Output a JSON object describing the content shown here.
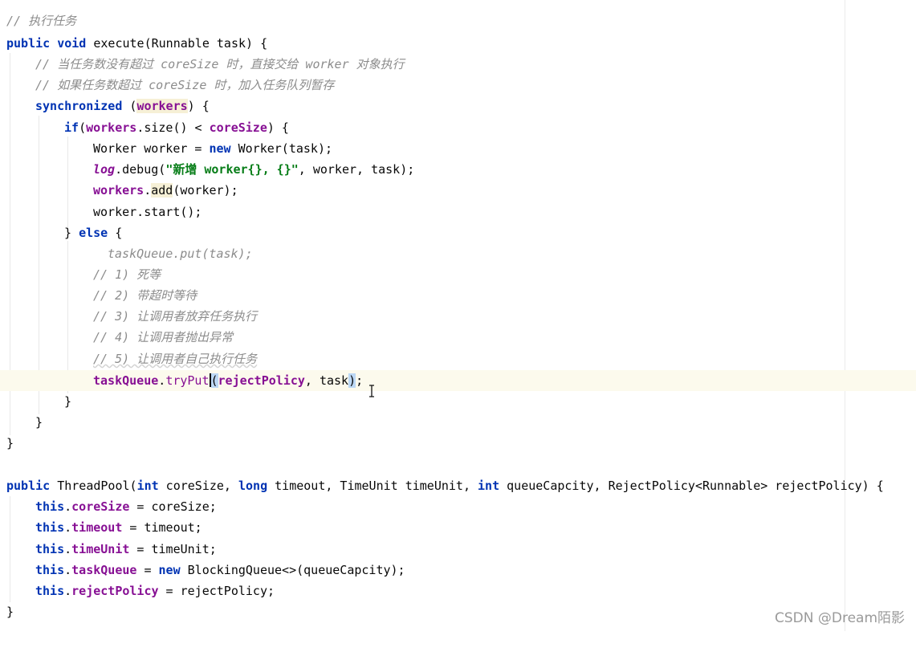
{
  "editor": {
    "lines": [
      {
        "t": "// 执行任务",
        "kind": "comment"
      },
      {
        "t": "public void execute(Runnable task) {",
        "kind": "code"
      },
      {
        "t": "// 当任务数没有超过 coreSize 时，直接交给 worker 对象执行",
        "kind": "comment"
      },
      {
        "t": "// 如果任务数超过 coreSize 时，加入任务队列暂存",
        "kind": "comment"
      },
      {
        "t": "synchronized (workers) {",
        "kind": "code"
      },
      {
        "t": "if(workers.size() < coreSize) {",
        "kind": "code"
      },
      {
        "t": "Worker worker = new Worker(task);",
        "kind": "code"
      },
      {
        "t": "log.debug(\"新增 worker{}, {}\", worker, task);",
        "kind": "code"
      },
      {
        "t": "workers.add(worker);",
        "kind": "code"
      },
      {
        "t": "worker.start();",
        "kind": "code"
      },
      {
        "t": "} else {",
        "kind": "code"
      },
      {
        "t": "taskQueue.put(task);",
        "kind": "code-disabled"
      },
      {
        "t": "// 1) 死等",
        "kind": "comment"
      },
      {
        "t": "// 2) 带超时等待",
        "kind": "comment"
      },
      {
        "t": "// 3) 让调用者放弃任务执行",
        "kind": "comment"
      },
      {
        "t": "// 4) 让调用者抛出异常",
        "kind": "comment"
      },
      {
        "t": "// 5) 让调用者自己执行任务",
        "kind": "comment"
      },
      {
        "t": "taskQueue.tryPut(rejectPolicy, task);",
        "kind": "code-current"
      },
      {
        "t": "}",
        "kind": "code"
      },
      {
        "t": "}",
        "kind": "code"
      },
      {
        "t": "}",
        "kind": "code"
      },
      {
        "t": "",
        "kind": "blank"
      },
      {
        "t": "public ThreadPool(int coreSize, long timeout, TimeUnit timeUnit, int queueCapcity, RejectPolicy<Runnable> rejectPolicy) {",
        "kind": "code"
      },
      {
        "t": "this.coreSize = coreSize;",
        "kind": "code"
      },
      {
        "t": "this.timeout = timeout;",
        "kind": "code"
      },
      {
        "t": "this.timeUnit = timeUnit;",
        "kind": "code"
      },
      {
        "t": "this.taskQueue = new BlockingQueue<>(queueCapcity);",
        "kind": "code"
      },
      {
        "t": "this.rejectPolicy = rejectPolicy;",
        "kind": "code"
      },
      {
        "t": "}",
        "kind": "code"
      }
    ],
    "tokens": {
      "l0_c": "// 执行任务",
      "l1_kw1": "public",
      "l1_kw2": "void",
      "l1_rest": " execute(Runnable task) {",
      "l2_c": "// 当任务数没有超过 coreSize 时，直接交给 worker 对象执行",
      "l3_c": "// 如果任务数超过 coreSize 时，加入任务队列暂存",
      "l4_kw": "synchronized",
      "l4_a": " (",
      "l4_f": "workers",
      "l4_b": ") {",
      "l5_kw": "if",
      "l5_a": "(",
      "l5_f1": "workers",
      "l5_b": ".size() < ",
      "l5_f2": "coreSize",
      "l5_c": ") {",
      "l6_a": "Worker worker = ",
      "l6_kw": "new",
      "l6_b": " Worker(task);",
      "l7_f": "log",
      "l7_a": ".debug(",
      "l7_s": "\"新增 worker{}, {}\"",
      "l7_b": ", worker, task);",
      "l8_f": "workers",
      "l8_a": ".",
      "l8_m": "add",
      "l8_b": "(worker);",
      "l9_a": "worker.start();",
      "l10_a": "} ",
      "l10_kw": "else",
      "l10_b": " {",
      "l11_a": "taskQueue.put(task);",
      "l12_c": "// 1) 死等",
      "l13_c": "// 2) 带超时等待",
      "l14_c": "// 3) 让调用者放弃任务执行",
      "l15_c": "// 4) 让调用者抛出异常",
      "l16_c": "// 5) 让调用者自己执行任务",
      "l17_f1": "taskQueue",
      "l17_a": ".",
      "l17_m": "tryPut",
      "l17_p1": "(",
      "l17_f2": "rejectPolicy",
      "l17_b": ", task",
      "l17_p2": ")",
      "l17_c": ";",
      "l18": "}",
      "l19": "}",
      "l20": "}",
      "l22_kw1": "public",
      "l22_a": " ThreadPool(",
      "l22_kw2": "int",
      "l22_b": " coreSize, ",
      "l22_kw3": "long",
      "l22_c": " timeout, TimeUnit timeUnit, ",
      "l22_kw4": "int",
      "l22_d": " queueCapcity, RejectPolicy<Runnable> rejectPolicy) {",
      "l23_kw": "this",
      "l23_a": ".",
      "l23_f": "coreSize",
      "l23_b": " = coreSize;",
      "l24_kw": "this",
      "l24_a": ".",
      "l24_f": "timeout",
      "l24_b": " = timeout;",
      "l25_kw": "this",
      "l25_a": ".",
      "l25_f": "timeUnit",
      "l25_b": " = timeUnit;",
      "l26_kw": "this",
      "l26_a": ".",
      "l26_f": "taskQueue",
      "l26_b": " = ",
      "l26_kw2": "new",
      "l26_c": " BlockingQueue<>(queueCapcity);",
      "l27_kw": "this",
      "l27_a": ".",
      "l27_f": "rejectPolicy",
      "l27_b": " = rejectPolicy;",
      "l28": "}"
    }
  },
  "watermark": "CSDN @Dream陌影",
  "colors": {
    "keyword": "#0033b3",
    "comment": "#8c8c8c",
    "field": "#871094",
    "string": "#067d17",
    "current_line": "#fcfaed",
    "bracket_match": "#bcd8f5"
  }
}
